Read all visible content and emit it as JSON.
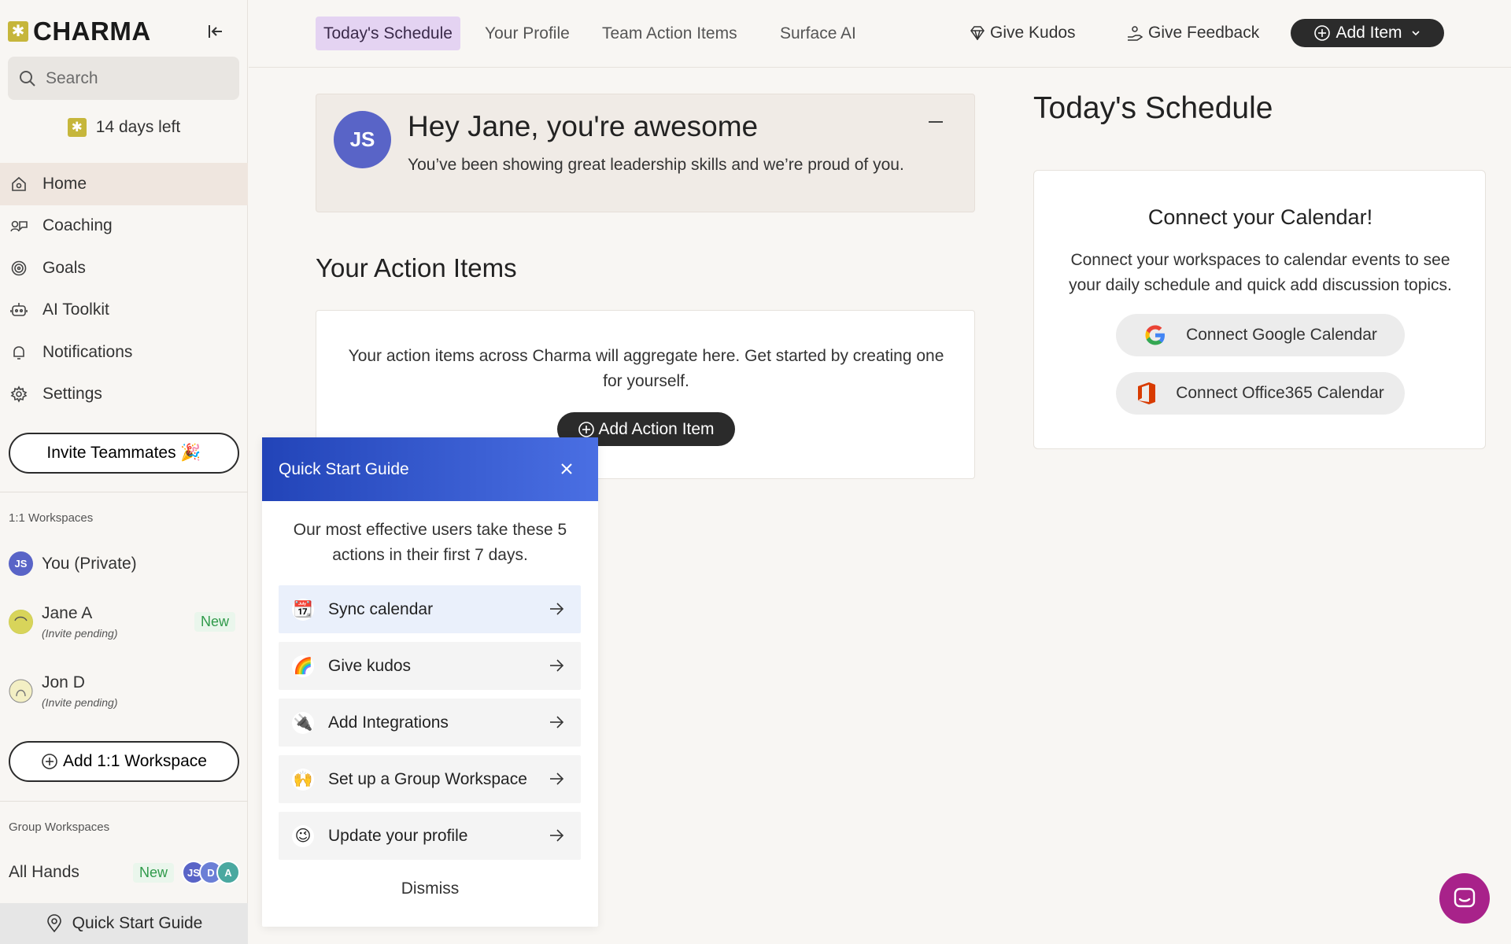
{
  "app": {
    "name": "CHARMA",
    "trial_text": "14 days left"
  },
  "search": {
    "placeholder": "Search"
  },
  "sidebar": {
    "nav": [
      {
        "label": "Home",
        "icon": "home-icon"
      },
      {
        "label": "Coaching",
        "icon": "coaching-icon"
      },
      {
        "label": "Goals",
        "icon": "target-icon"
      },
      {
        "label": "AI Toolkit",
        "icon": "robot-icon"
      },
      {
        "label": "Notifications",
        "icon": "bell-icon"
      },
      {
        "label": "Settings",
        "icon": "gear-icon"
      }
    ],
    "invite_label": "Invite Teammates 🎉",
    "one_on_one_label": "1:1 Workspaces",
    "workspaces": [
      {
        "name": "You (Private)",
        "initials": "JS"
      },
      {
        "name": "Jane A",
        "sub": "(Invite pending)",
        "badge": "New"
      },
      {
        "name": "Jon D",
        "sub": "(Invite pending)"
      }
    ],
    "add_workspace_label": "Add 1:1 Workspace",
    "group_label": "Group Workspaces",
    "group": {
      "name": "All Hands",
      "badge": "New",
      "members": [
        "JS",
        "D",
        "A"
      ]
    },
    "quick_start_label": "Quick Start Guide"
  },
  "topnav": {
    "tabs": [
      "Today's Schedule",
      "Your Profile",
      "Team Action Items",
      "Surface AI"
    ],
    "give_kudos": "Give Kudos",
    "give_feedback": "Give Feedback",
    "add_item": "Add Item"
  },
  "hey_card": {
    "initials": "JS",
    "title": "Hey Jane, you're awesome",
    "subtitle": "You’ve been showing great leadership skills and we’re proud of you."
  },
  "action_items": {
    "title": "Your Action Items",
    "empty_text": "Your action items across Charma will aggregate here. Get started by creating one for yourself.",
    "add_label": "Add Action Item"
  },
  "schedule": {
    "title": "Today's Schedule",
    "card_title": "Connect your Calendar!",
    "card_text": "Connect your workspaces to calendar events to see your daily schedule and quick add discussion topics.",
    "google_label": "Connect Google Calendar",
    "office_label": "Connect Office365 Calendar"
  },
  "quick_start": {
    "title": "Quick Start Guide",
    "intro": "Our most effective users take these 5 actions in their first 7 days.",
    "items": [
      {
        "label": "Sync calendar",
        "emoji": "📆"
      },
      {
        "label": "Give kudos",
        "emoji": "🌈"
      },
      {
        "label": "Add Integrations",
        "emoji": "🔌"
      },
      {
        "label": "Set up a Group Workspace",
        "emoji": "🙌"
      },
      {
        "label": "Update your profile",
        "emoji": "😉"
      }
    ],
    "dismiss": "Dismiss"
  },
  "colors": {
    "accent_purple": "#e4d3f2",
    "dark_button": "#2b2b2b",
    "avatar_blue": "#5964c7",
    "popup_header": "#2244b8",
    "new_badge": "#2f9a4a",
    "chat": "#a8228a"
  }
}
